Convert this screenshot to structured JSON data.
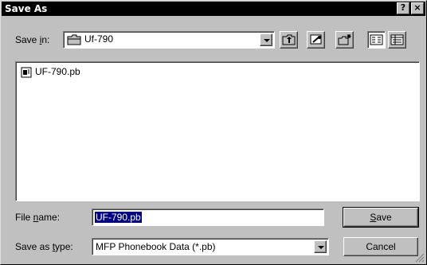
{
  "window": {
    "title": "Save As",
    "help_label": "?",
    "close_label": "×"
  },
  "save_in": {
    "label_pre": "Save ",
    "label_u": "i",
    "label_post": "n:",
    "folder_icon": "folder-icon",
    "value": "Uf-790"
  },
  "toolbar": {
    "icons": [
      "up-one-level-icon",
      "desktop-icon",
      "new-folder-icon",
      "list-view-icon",
      "details-view-icon"
    ]
  },
  "files": [
    {
      "name": "UF-790.pb",
      "icon": "document-icon"
    }
  ],
  "file_name": {
    "label_pre": "File ",
    "label_u": "n",
    "label_post": "ame:",
    "value": "UF-790.pb"
  },
  "save_as_type": {
    "label_pre": "Save as ",
    "label_u": "t",
    "label_post": "ype:",
    "value": "MFP Phonebook Data (*.pb)"
  },
  "buttons": {
    "save_u": "S",
    "save_rest": "ave",
    "cancel": "Cancel"
  }
}
